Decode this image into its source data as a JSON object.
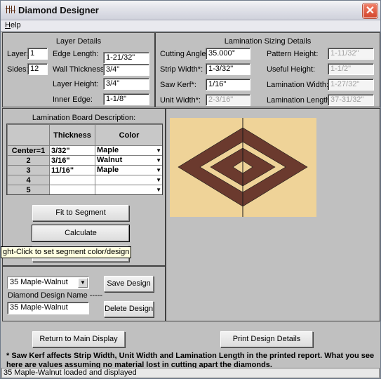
{
  "window": {
    "title": "Diamond Designer",
    "close_glyph": "✕"
  },
  "menu": {
    "help": "Help",
    "help_accel": "H",
    "help_rest": "elp"
  },
  "layer_details": {
    "heading": "Layer Details",
    "layer_label": "Layer:",
    "layer_value": "1",
    "sides_label": "Sides:",
    "sides_value": "12",
    "edge_length_label": "Edge Length:",
    "edge_length_value": "1-21/32\"",
    "wall_thickness_label": "Wall Thickness:",
    "wall_thickness_value": "3/4\"",
    "layer_height_label": "Layer Height:",
    "layer_height_value": "3/4\"",
    "inner_edge_label": "Inner Edge:",
    "inner_edge_value": "1-1/8\""
  },
  "lamination_sizing": {
    "heading": "Lamination Sizing Details",
    "cutting_angle_label": "Cutting Angle:",
    "cutting_angle_value": "35.000°",
    "strip_width_label": "Strip Width*:",
    "strip_width_value": "1-3/32\"",
    "saw_kerf_label": "Saw Kerf*:",
    "saw_kerf_value": "1/16\"",
    "unit_width_label": "Unit Width*:",
    "unit_width_value": "2-3/16\"",
    "pattern_height_label": "Pattern Height:",
    "pattern_height_value": "1-11/32\"",
    "useful_height_label": "Useful Height:",
    "useful_height_value": "1-1/2\"",
    "lamination_width_label": "Lamination Width:",
    "lamination_width_value": "1-27/32\"",
    "lamination_length_label": "Lamination Length*:",
    "lamination_length_value": "37-31/32\""
  },
  "board_description": {
    "heading": "Lamination Board Description:",
    "columns": [
      "",
      "Thickness",
      "Color"
    ],
    "rows": [
      {
        "row": "Center=1",
        "thickness": "3/32\"",
        "color": "Maple"
      },
      {
        "row": "2",
        "thickness": "3/16\"",
        "color": "Walnut"
      },
      {
        "row": "3",
        "thickness": "11/16\"",
        "color": "Maple"
      },
      {
        "row": "4",
        "thickness": "",
        "color": ""
      },
      {
        "row": "5",
        "thickness": "",
        "color": ""
      }
    ],
    "dropdown_glyph": "▼"
  },
  "buttons": {
    "fit_to_segment": "Fit to Segment",
    "calculate": "Calculate",
    "save_design": "Save Design",
    "delete_design": "Delete Design",
    "return_main": "Return to Main Display",
    "print_details": "Print Design Details"
  },
  "tooltip": "ght-Click to set segment color/design",
  "design": {
    "selected": "35 Maple-Walnut",
    "name_label": "Diamond Design Name -----",
    "name_value": "35 Maple-Walnut"
  },
  "preview": {
    "colors": {
      "maple": "#efd398",
      "walnut": "#6b3a2e",
      "line": "#1a1a1a"
    }
  },
  "note": "* Saw Kerf affects Strip Width, Unit Width and Lamination Length in the printed report. What you see here are values assuming no material lost in cutting apart the diamonds.",
  "status": "35 Maple-Walnut loaded and displayed"
}
